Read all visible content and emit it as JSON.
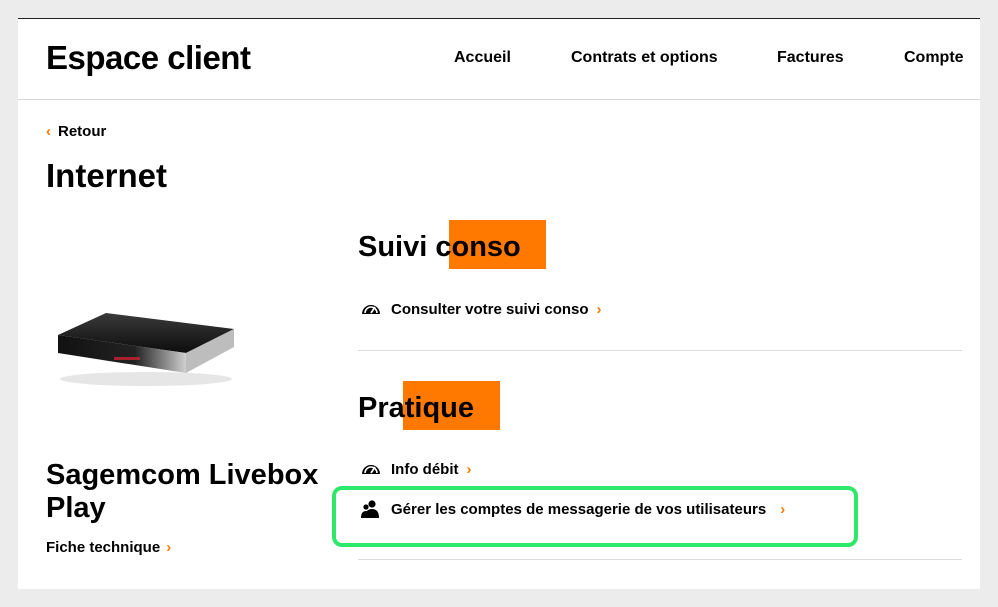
{
  "header": {
    "brand": "Espace client",
    "nav": [
      "Accueil",
      "Contrats et options",
      "Factures",
      "Compte"
    ]
  },
  "back": {
    "label": "Retour",
    "icon": "chevron-left-icon"
  },
  "page_title": "Internet",
  "device": {
    "name": "Sagemcom Livebox Play",
    "link": "Fiche technique"
  },
  "sections": [
    {
      "title": "Suivi conso",
      "items": [
        {
          "label": "Consulter votre suivi conso",
          "icon": "gauge-icon"
        }
      ]
    },
    {
      "title": "Pratique",
      "items": [
        {
          "label": "Info débit",
          "icon": "gauge-icon"
        },
        {
          "label": "Gérer les comptes de messagerie de vos utilisateurs",
          "icon": "users-icon"
        }
      ]
    }
  ],
  "colors": {
    "accent": "#ff7900",
    "highlight": "#2ee86a"
  }
}
